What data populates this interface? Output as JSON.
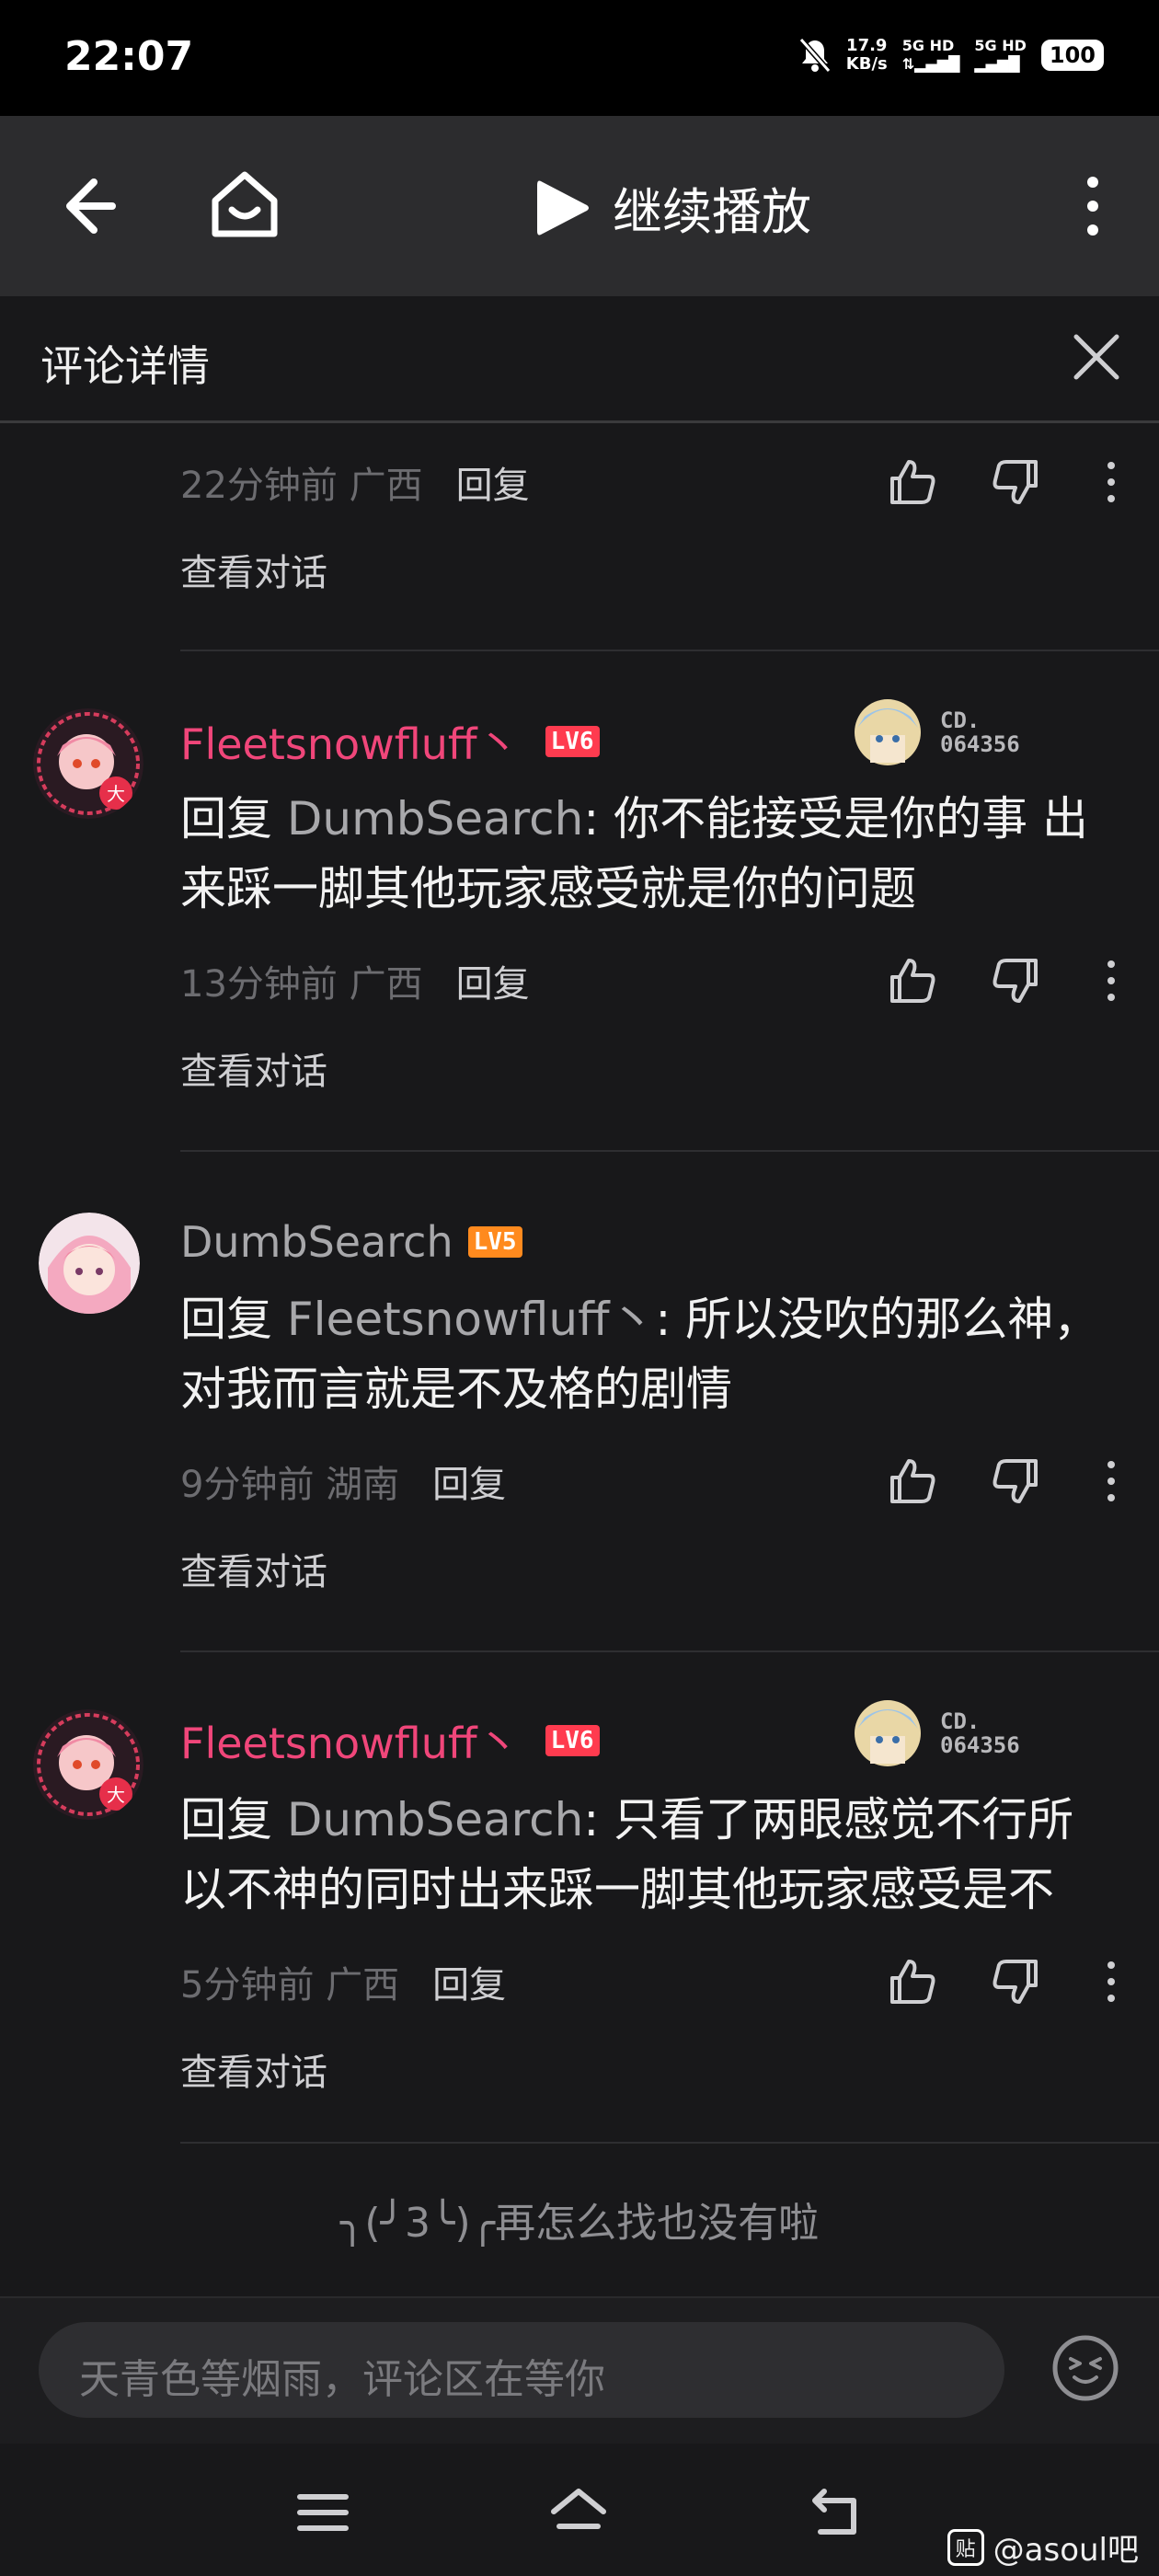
{
  "status_bar": {
    "time": "22:07",
    "net_speed": "17.9",
    "net_unit": "KB/s",
    "sim1": "5G HD",
    "sim2": "5G HD",
    "battery": "100"
  },
  "top_bar": {
    "play_label": "继续播放"
  },
  "header": {
    "title": "评论详情"
  },
  "comments": [
    {
      "time_loc": "22分钟前  广西",
      "reply_label": "回复",
      "view_conversation": "查看对话"
    },
    {
      "username": "Fleetsnowfluff丶",
      "level": "LV6",
      "badge_code_line1": "CD.",
      "badge_code_line2": "064356",
      "reply_prefix": "回复 ",
      "reply_to": "DumbSearch",
      "text": ": 你不能接受是你的事 出来踩一脚其他玩家感受就是你的问题",
      "time_loc": "13分钟前  广西",
      "reply_label": "回复",
      "view_conversation": "查看对话"
    },
    {
      "username": "DumbSearch",
      "level": "LV5",
      "reply_prefix": "回复 ",
      "reply_to": "Fleetsnowfluff丶",
      "text": ": 所以没吹的那么神，对我而言就是不及格的剧情",
      "time_loc": "9分钟前  湖南",
      "reply_label": "回复",
      "view_conversation": "查看对话"
    },
    {
      "username": "Fleetsnowfluff丶",
      "level": "LV6",
      "badge_code_line1": "CD.",
      "badge_code_line2": "064356",
      "reply_prefix": "回复 ",
      "reply_to": "DumbSearch",
      "text": ": 只看了两眼感觉不行所以不神的同时出来踩一脚其他玩家感受是不",
      "time_loc": "5分钟前  广西",
      "reply_label": "回复",
      "view_conversation": "查看对话"
    }
  ],
  "end_of_list": "╮(╯3╰)╭再怎么找也没有啦",
  "input_bar": {
    "placeholder": "天青色等烟雨，评论区在等你"
  },
  "watermark": {
    "icon_text": "贴",
    "text": "@asoul吧"
  },
  "icons": [
    "back-arrow-icon",
    "home-icon",
    "play-icon",
    "more-vertical-icon",
    "close-icon",
    "like-icon",
    "dislike-icon",
    "emoji-icon",
    "menu-icon",
    "nav-home-icon",
    "nav-back-icon"
  ],
  "colors": {
    "username_pink": "#f0467a",
    "level6": "#ff3b4f",
    "level5": "#ff8a1e",
    "background": "#18181a"
  }
}
